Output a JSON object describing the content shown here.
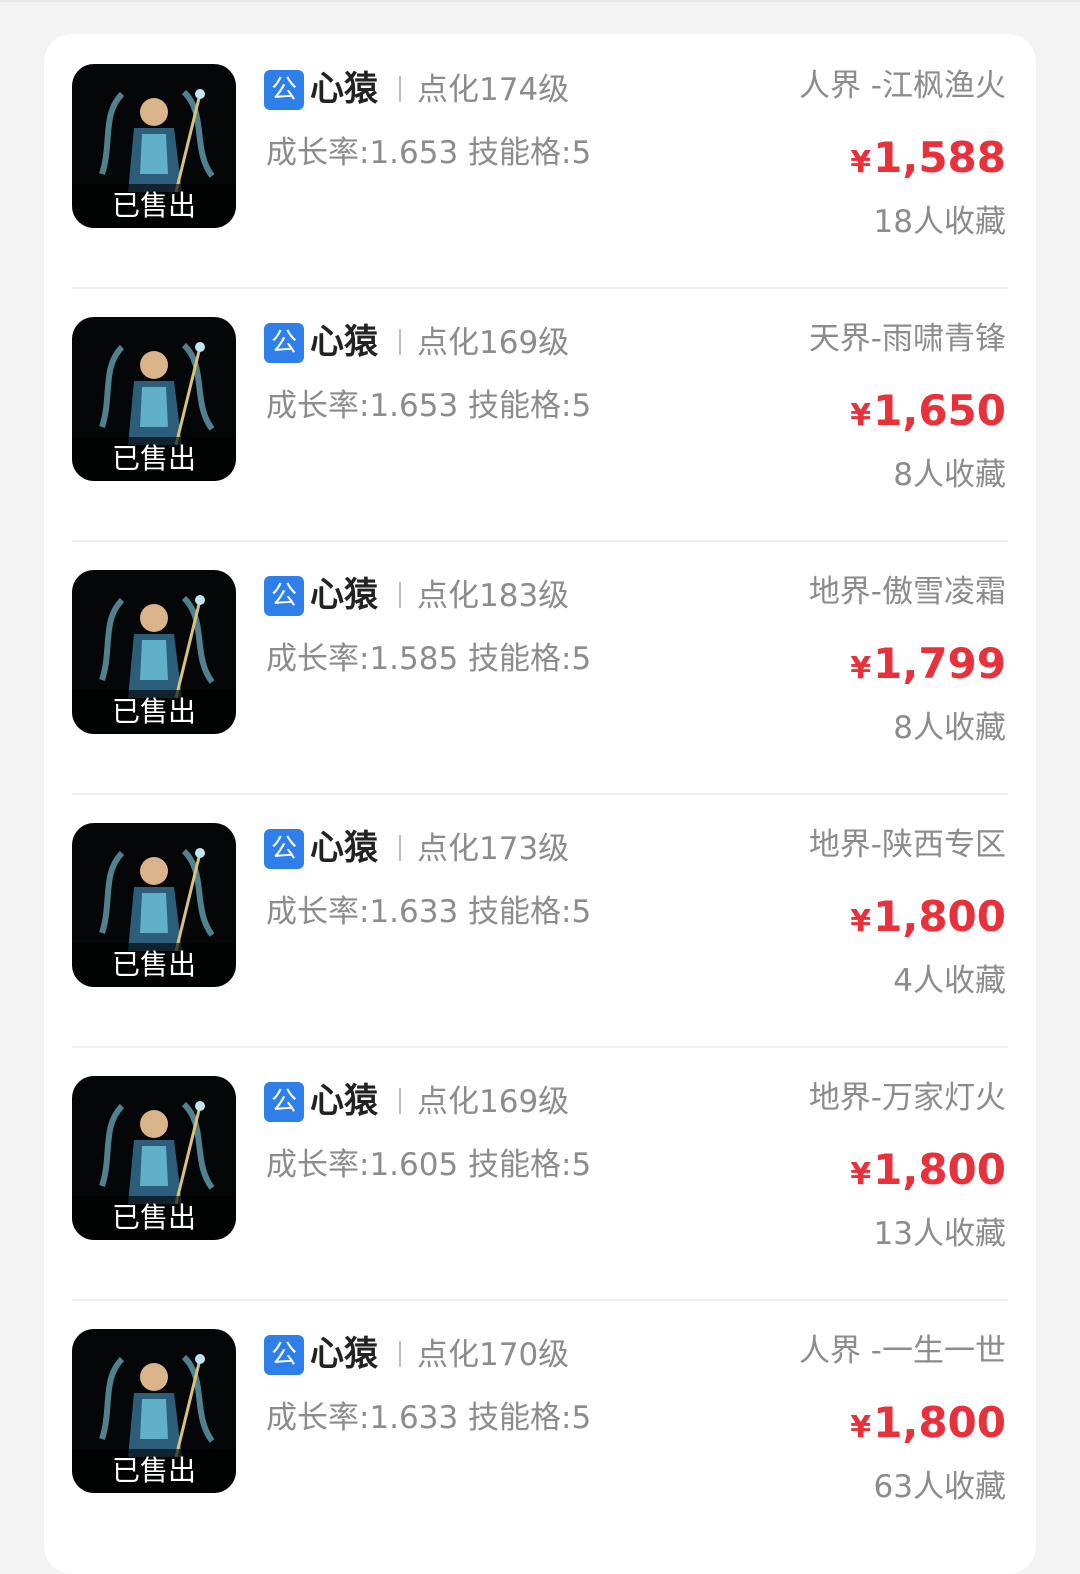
{
  "colors": {
    "accent_badge": "#2f7fea",
    "price": "#e8313a",
    "secondary_text": "#8c8c8c",
    "primary_text": "#222222",
    "background": "#f3f3f3"
  },
  "listings": [
    {
      "badge": "公",
      "name": "心猿",
      "level": "点化174级",
      "attributes": "成长率:1.653 技能格:5",
      "server": "人界 -江枫渔火",
      "currency": "¥",
      "price": "1,588",
      "favorites": "18人收藏",
      "status": "已售出"
    },
    {
      "badge": "公",
      "name": "心猿",
      "level": "点化169级",
      "attributes": "成长率:1.653 技能格:5",
      "server": "天界-雨啸青锋",
      "currency": "¥",
      "price": "1,650",
      "favorites": "8人收藏",
      "status": "已售出"
    },
    {
      "badge": "公",
      "name": "心猿",
      "level": "点化183级",
      "attributes": "成长率:1.585 技能格:5",
      "server": "地界-傲雪凌霜",
      "currency": "¥",
      "price": "1,799",
      "favorites": "8人收藏",
      "status": "已售出"
    },
    {
      "badge": "公",
      "name": "心猿",
      "level": "点化173级",
      "attributes": "成长率:1.633 技能格:5",
      "server": "地界-陕西专区",
      "currency": "¥",
      "price": "1,800",
      "favorites": "4人收藏",
      "status": "已售出"
    },
    {
      "badge": "公",
      "name": "心猿",
      "level": "点化169级",
      "attributes": "成长率:1.605 技能格:5",
      "server": "地界-万家灯火",
      "currency": "¥",
      "price": "1,800",
      "favorites": "13人收藏",
      "status": "已售出"
    },
    {
      "badge": "公",
      "name": "心猿",
      "level": "点化170级",
      "attributes": "成长率:1.633 技能格:5",
      "server": "人界 -一生一世",
      "currency": "¥",
      "price": "1,800",
      "favorites": "63人收藏",
      "status": "已售出"
    }
  ]
}
